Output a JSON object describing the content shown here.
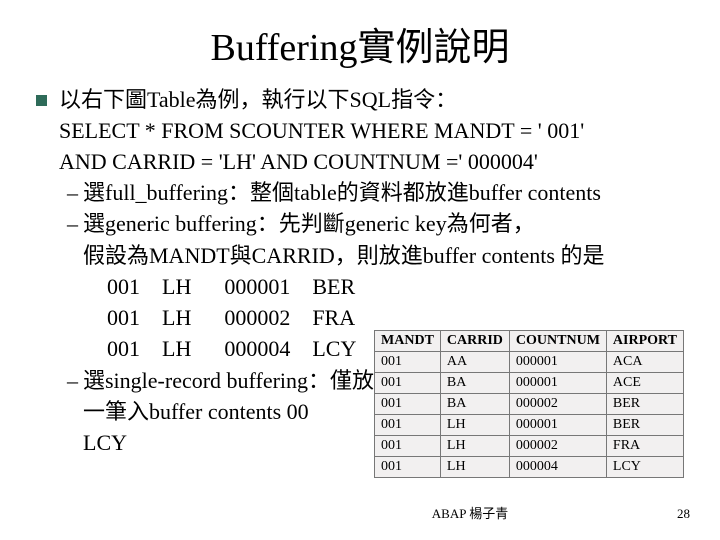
{
  "title": "Buffering實例說明",
  "top_bullet": "以右下圖Table為例，執行以下SQL指令：",
  "sql_line1": "SELECT * FROM SCOUNTER WHERE MANDT = ' 001'",
  "sql_line2": "AND CARRID = 'LH' AND COUNTNUM =' 000004'",
  "sub1": "選full_buffering：整個table的資料都放進buffer contents",
  "sub2_l1": "選generic buffering：先判斷generic key為何者，",
  "sub2_l2": "假設為MANDT與CARRID，則放進buffer contents 的是",
  "rows_inline": {
    "r1": "001    LH      000001    BER",
    "r2": "001    LH      000002    FRA",
    "r3": "001    LH      000004    LCY"
  },
  "sub3_l1": "選single-record buffering：僅放",
  "sub3_l2": "一筆入buffer contents            00",
  "sub3_l3": "LCY",
  "footer_center": "ABAP  楊子青",
  "footer_page": "28",
  "chart_data": {
    "type": "table",
    "headers": [
      "MANDT",
      "CARRID",
      "COUNTNUM",
      "AIRPORT"
    ],
    "rows": [
      [
        "001",
        "AA",
        "000001",
        "ACA"
      ],
      [
        "001",
        "BA",
        "000001",
        "ACE"
      ],
      [
        "001",
        "BA",
        "000002",
        "BER"
      ],
      [
        "001",
        "LH",
        "000001",
        "BER"
      ],
      [
        "001",
        "LH",
        "000002",
        "FRA"
      ],
      [
        "001",
        "LH",
        "000004",
        "LCY"
      ]
    ]
  }
}
